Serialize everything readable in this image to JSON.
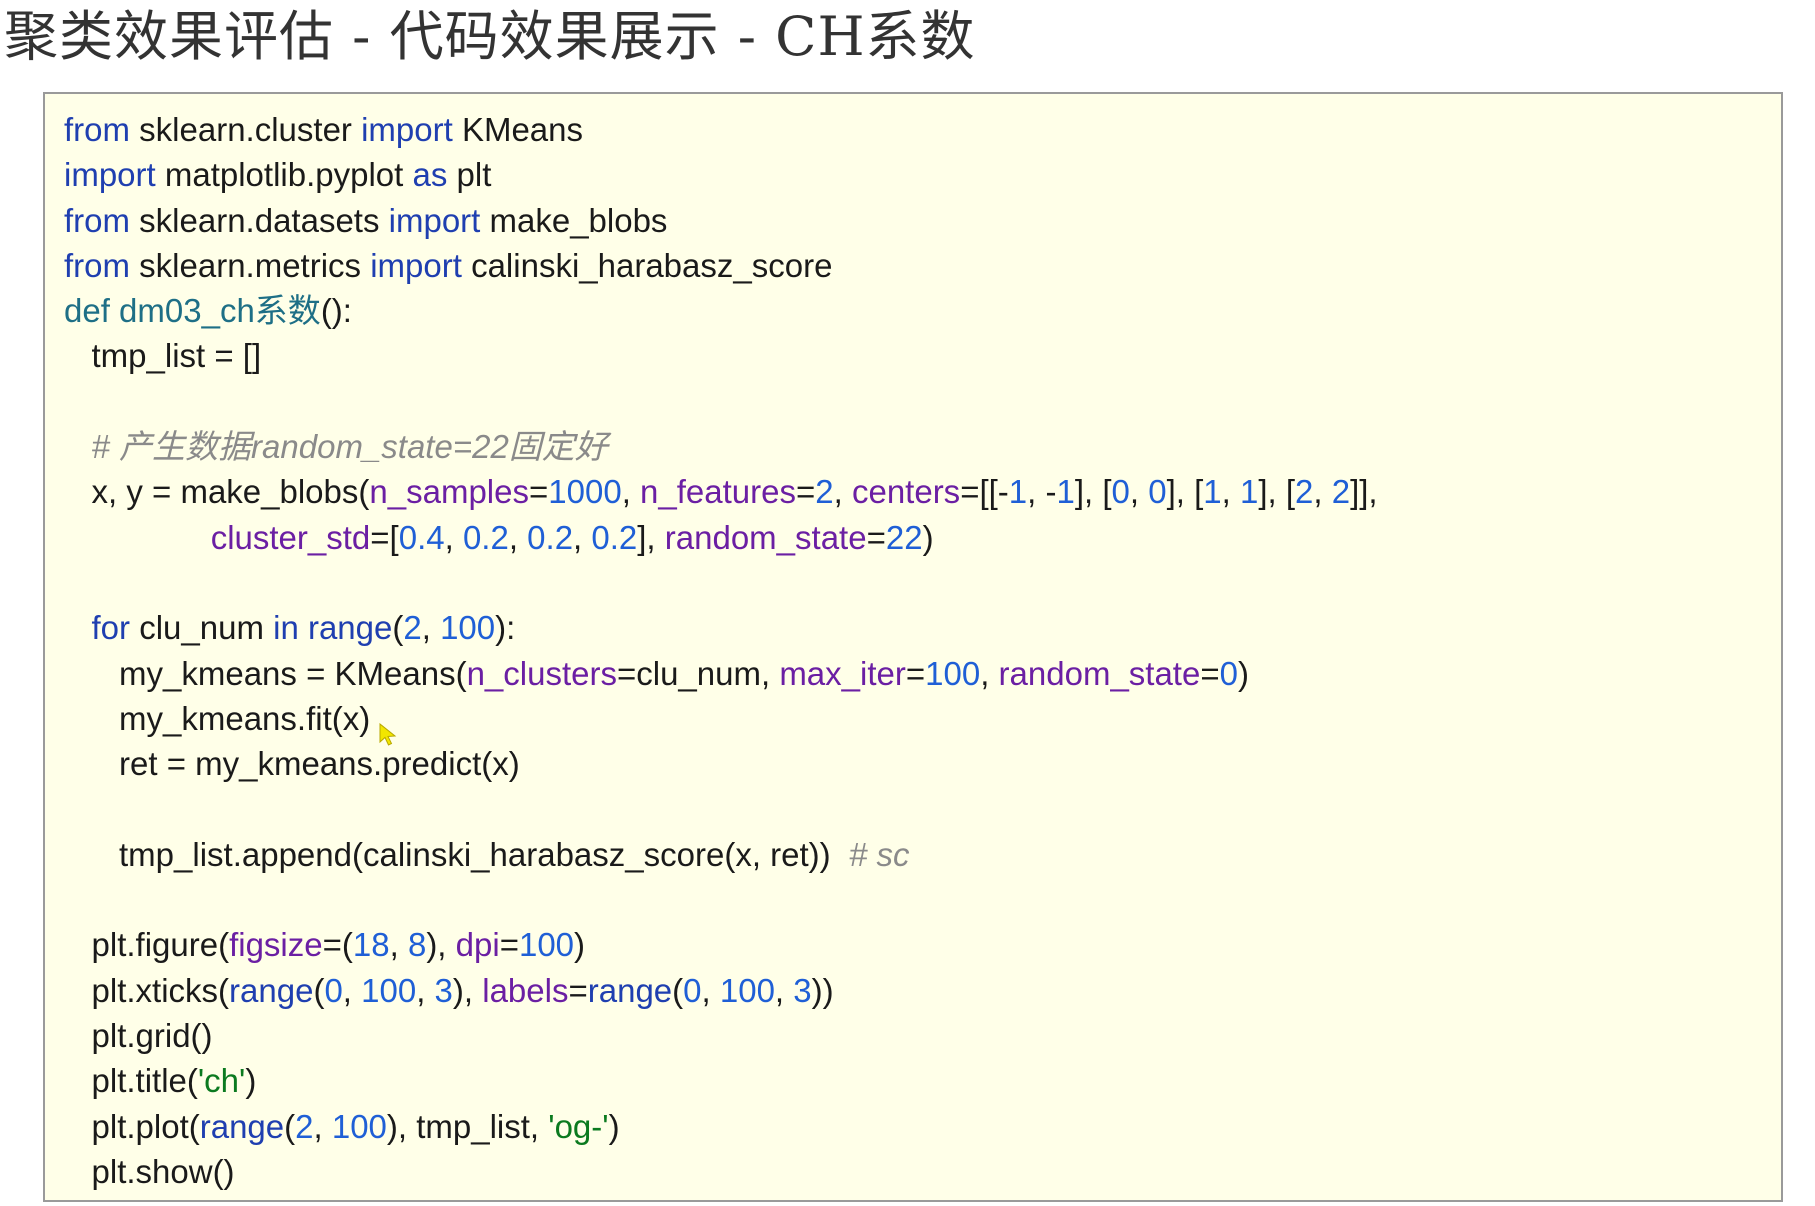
{
  "slide": {
    "title": "聚类效果评估 - 代码效果展示 - CH系数"
  },
  "colors": {
    "panel_background": "#ffffe8",
    "panel_border": "#9a9a9a",
    "keyword": "#1f3fb0",
    "function_def": "#1e6f86",
    "parameter": "#6b1fa3",
    "number": "#1f5fd6",
    "string": "#0b7a1f",
    "comment": "#8a8a8a"
  },
  "cursor": {
    "icon": "mouse-pointer-icon",
    "color": "#f2e600"
  },
  "code": {
    "lines": [
      [
        [
          "kw",
          "from"
        ],
        [
          "plain",
          " sklearn.cluster "
        ],
        [
          "kw",
          "import"
        ],
        [
          "plain",
          " KMeans"
        ]
      ],
      [
        [
          "kw",
          "import"
        ],
        [
          "plain",
          " matplotlib.pyplot "
        ],
        [
          "kw",
          "as"
        ],
        [
          "plain",
          " plt"
        ]
      ],
      [
        [
          "kw",
          "from"
        ],
        [
          "plain",
          " sklearn.datasets "
        ],
        [
          "kw",
          "import"
        ],
        [
          "plain",
          " make_blobs"
        ]
      ],
      [
        [
          "kw",
          "from"
        ],
        [
          "plain",
          " sklearn.metrics "
        ],
        [
          "kw",
          "import"
        ],
        [
          "plain",
          " calinski_harabasz_score"
        ]
      ],
      [
        [
          "def",
          "def"
        ],
        [
          "plain",
          " "
        ],
        [
          "fn",
          "dm03_ch系数"
        ],
        [
          "plain",
          "():"
        ]
      ],
      [
        [
          "plain",
          "   tmp_list = []"
        ]
      ],
      [],
      [
        [
          "plain",
          "   "
        ],
        [
          "comment",
          "# 产生数据random_state=22固定好"
        ]
      ],
      [
        [
          "plain",
          "   x, y = make_blobs("
        ],
        [
          "param",
          "n_samples"
        ],
        [
          "plain",
          "="
        ],
        [
          "num",
          "1000"
        ],
        [
          "plain",
          ", "
        ],
        [
          "param",
          "n_features"
        ],
        [
          "plain",
          "="
        ],
        [
          "num",
          "2"
        ],
        [
          "plain",
          ", "
        ],
        [
          "param",
          "centers"
        ],
        [
          "plain",
          "=[[-"
        ],
        [
          "num",
          "1"
        ],
        [
          "plain",
          ", -"
        ],
        [
          "num",
          "1"
        ],
        [
          "plain",
          "], ["
        ],
        [
          "num",
          "0"
        ],
        [
          "plain",
          ", "
        ],
        [
          "num",
          "0"
        ],
        [
          "plain",
          "], ["
        ],
        [
          "num",
          "1"
        ],
        [
          "plain",
          ", "
        ],
        [
          "num",
          "1"
        ],
        [
          "plain",
          "], ["
        ],
        [
          "num",
          "2"
        ],
        [
          "plain",
          ", "
        ],
        [
          "num",
          "2"
        ],
        [
          "plain",
          "]],"
        ]
      ],
      [
        [
          "plain",
          "                "
        ],
        [
          "param",
          "cluster_std"
        ],
        [
          "plain",
          "=["
        ],
        [
          "num",
          "0.4"
        ],
        [
          "plain",
          ", "
        ],
        [
          "num",
          "0.2"
        ],
        [
          "plain",
          ", "
        ],
        [
          "num",
          "0.2"
        ],
        [
          "plain",
          ", "
        ],
        [
          "num",
          "0.2"
        ],
        [
          "plain",
          "], "
        ],
        [
          "param",
          "random_state"
        ],
        [
          "plain",
          "="
        ],
        [
          "num",
          "22"
        ],
        [
          "plain",
          ")"
        ]
      ],
      [],
      [
        [
          "plain",
          "   "
        ],
        [
          "kw",
          "for"
        ],
        [
          "plain",
          " clu_num "
        ],
        [
          "kw",
          "in"
        ],
        [
          "plain",
          " "
        ],
        [
          "builtin",
          "range"
        ],
        [
          "plain",
          "("
        ],
        [
          "num",
          "2"
        ],
        [
          "plain",
          ", "
        ],
        [
          "num",
          "100"
        ],
        [
          "plain",
          "):"
        ]
      ],
      [
        [
          "plain",
          "      my_kmeans = KMeans("
        ],
        [
          "param",
          "n_clusters"
        ],
        [
          "plain",
          "=clu_num, "
        ],
        [
          "param",
          "max_iter"
        ],
        [
          "plain",
          "="
        ],
        [
          "num",
          "100"
        ],
        [
          "plain",
          ", "
        ],
        [
          "param",
          "random_state"
        ],
        [
          "plain",
          "="
        ],
        [
          "num",
          "0"
        ],
        [
          "plain",
          ")"
        ]
      ],
      [
        [
          "plain",
          "      my_kmeans.fit(x)"
        ]
      ],
      [
        [
          "plain",
          "      ret = my_kmeans.predict(x)"
        ]
      ],
      [],
      [
        [
          "plain",
          "      tmp_list.append(calinski_harabasz_score(x, ret))  "
        ],
        [
          "comment",
          "# sc"
        ]
      ],
      [],
      [
        [
          "plain",
          "   plt.figure("
        ],
        [
          "param",
          "figsize"
        ],
        [
          "plain",
          "=("
        ],
        [
          "num",
          "18"
        ],
        [
          "plain",
          ", "
        ],
        [
          "num",
          "8"
        ],
        [
          "plain",
          "), "
        ],
        [
          "param",
          "dpi"
        ],
        [
          "plain",
          "="
        ],
        [
          "num",
          "100"
        ],
        [
          "plain",
          ")"
        ]
      ],
      [
        [
          "plain",
          "   plt.xticks("
        ],
        [
          "builtin",
          "range"
        ],
        [
          "plain",
          "("
        ],
        [
          "num",
          "0"
        ],
        [
          "plain",
          ", "
        ],
        [
          "num",
          "100"
        ],
        [
          "plain",
          ", "
        ],
        [
          "num",
          "3"
        ],
        [
          "plain",
          "), "
        ],
        [
          "param",
          "labels"
        ],
        [
          "plain",
          "="
        ],
        [
          "builtin",
          "range"
        ],
        [
          "plain",
          "("
        ],
        [
          "num",
          "0"
        ],
        [
          "plain",
          ", "
        ],
        [
          "num",
          "100"
        ],
        [
          "plain",
          ", "
        ],
        [
          "num",
          "3"
        ],
        [
          "plain",
          "))"
        ]
      ],
      [
        [
          "plain",
          "   plt.grid()"
        ]
      ],
      [
        [
          "plain",
          "   plt.title("
        ],
        [
          "str",
          "'ch'"
        ],
        [
          "plain",
          ")"
        ]
      ],
      [
        [
          "plain",
          "   plt.plot("
        ],
        [
          "builtin",
          "range"
        ],
        [
          "plain",
          "("
        ],
        [
          "num",
          "2"
        ],
        [
          "plain",
          ", "
        ],
        [
          "num",
          "100"
        ],
        [
          "plain",
          "), tmp_list, "
        ],
        [
          "str",
          "'og-'"
        ],
        [
          "plain",
          ")"
        ]
      ],
      [
        [
          "plain",
          "   plt.show()"
        ]
      ]
    ]
  }
}
